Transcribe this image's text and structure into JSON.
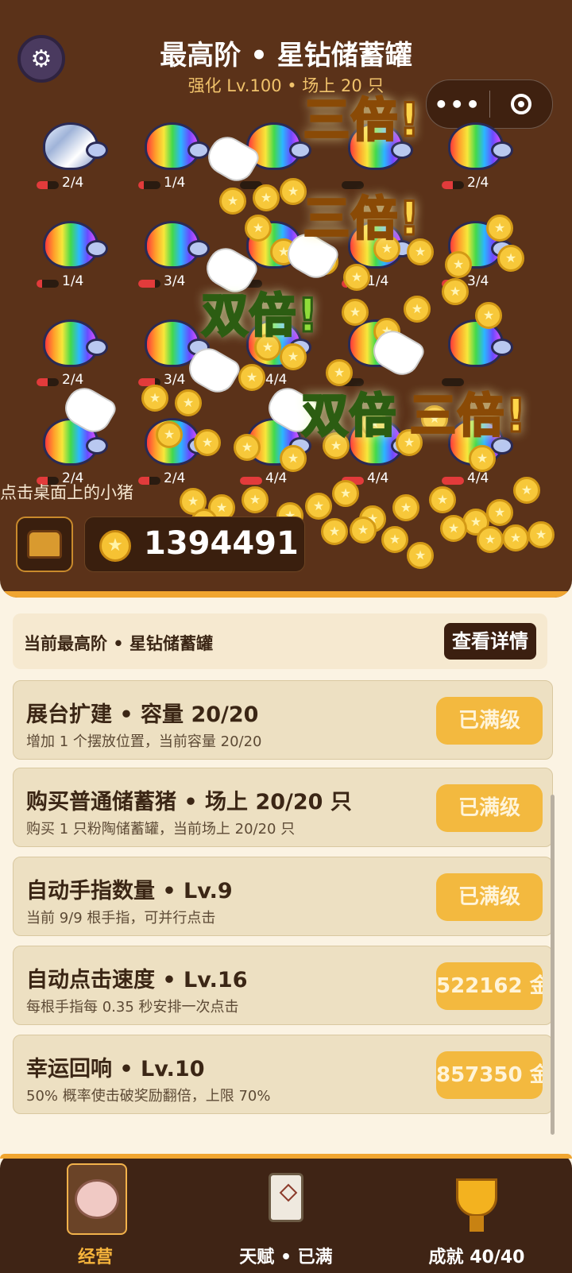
{
  "header": {
    "title": "最高阶 • 星钻储蓄罐",
    "subtitle": "强化 Lv.100 • 场上 20 只",
    "settings_icon": "gear-icon",
    "capsule_more": "•••",
    "capsule_record_icon": "record-icon"
  },
  "board": {
    "pigs": [
      {
        "count": "2/4",
        "type": "silver",
        "fill": 0.5
      },
      {
        "count": "1/4",
        "type": "rainbow",
        "fill": 0.25
      },
      {
        "count": "",
        "type": "rainbow",
        "fill": 0
      },
      {
        "count": "",
        "type": "rainbow",
        "fill": 0
      },
      {
        "count": "2/4",
        "type": "rainbow",
        "fill": 0.5
      },
      {
        "count": "1/4",
        "type": "rainbow",
        "fill": 0.25
      },
      {
        "count": "3/4",
        "type": "rainbow",
        "fill": 0.75
      },
      {
        "count": "",
        "type": "rainbow",
        "fill": 0
      },
      {
        "count": "1/4",
        "type": "rainbow",
        "fill": 0.25
      },
      {
        "count": "3/4",
        "type": "rainbow",
        "fill": 0.75
      },
      {
        "count": "2/4",
        "type": "rainbow",
        "fill": 0.5
      },
      {
        "count": "3/4",
        "type": "rainbow",
        "fill": 0.75
      },
      {
        "count": "4/4",
        "type": "rainbow",
        "fill": 1
      },
      {
        "count": "",
        "type": "rainbow",
        "fill": 0
      },
      {
        "count": "",
        "type": "rainbow",
        "fill": 0
      },
      {
        "count": "2/4",
        "type": "rainbow",
        "fill": 0.5
      },
      {
        "count": "2/4",
        "type": "rainbow",
        "fill": 0.5
      },
      {
        "count": "4/4",
        "type": "rainbow",
        "fill": 1
      },
      {
        "count": "4/4",
        "type": "rainbow",
        "fill": 1
      },
      {
        "count": "4/4",
        "type": "rainbow",
        "fill": 1
      }
    ],
    "boost_texts": [
      "三倍!",
      "三倍!",
      "双倍!",
      "双倍",
      "三倍!"
    ],
    "hint": "点击桌面上的小猪"
  },
  "wallet": {
    "chest_icon": "treasure-chest-icon",
    "coin_icon": "gold-coin-icon",
    "amount": "1394491"
  },
  "summary": {
    "label": "当前最高阶 • 星钻储蓄罐",
    "detail_button": "查看详情"
  },
  "upgrades": [
    {
      "title": "展台扩建 • 容量 20/20",
      "desc": "增加 1 个摆放位置，当前容量 20/20",
      "button": "已满级"
    },
    {
      "title": "购买普通储蓄猪 • 场上 20/20 只",
      "desc": "购买 1 只粉陶储蓄罐，当前场上 20/20 只",
      "button": "已满级"
    },
    {
      "title": "自动手指数量 • Lv.9",
      "desc": "当前 9/9 根手指，可并行点击",
      "button": "已满级"
    },
    {
      "title": "自动点击速度 • Lv.16",
      "desc": "每根手指每 0.35 秒安排一次点击",
      "button": "522162 金"
    },
    {
      "title": "幸运回响 • Lv.10",
      "desc": "50% 概率使击破奖励翻倍，上限 70%",
      "button": "857350 金"
    }
  ],
  "nav": {
    "tabs": [
      {
        "label": "经营",
        "icon": "piggy-bank-icon",
        "active": true
      },
      {
        "label": "天赋 • 已满",
        "icon": "scroll-icon",
        "active": false
      },
      {
        "label": "成就 40/40",
        "icon": "trophy-icon",
        "active": false
      }
    ]
  },
  "colors": {
    "top_bg": "#5b3219",
    "accent": "#f0a530",
    "button_gold": "#f3b93f",
    "page_bg": "#fbf3e3"
  }
}
